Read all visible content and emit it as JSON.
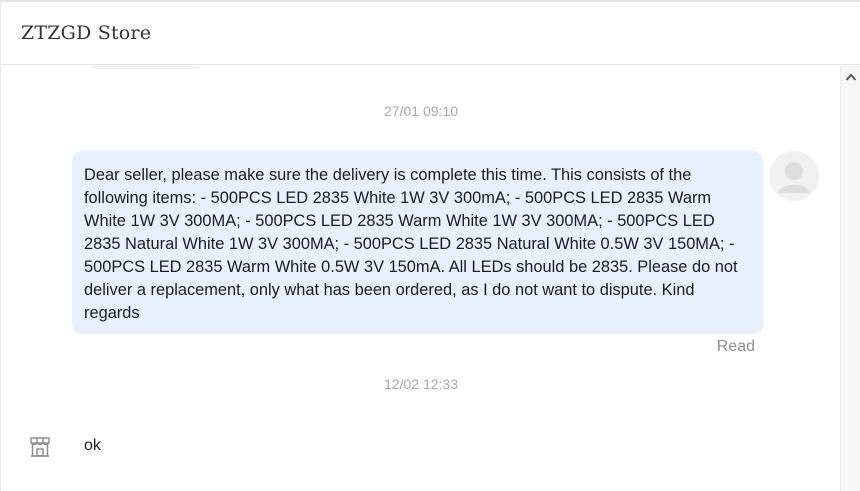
{
  "header": {
    "title": "ZTZGD Store"
  },
  "messages": [
    {
      "timestamp": "27/01 09:10",
      "sender": "user",
      "text": "Dear seller, please make sure the delivery is complete this time. This consists of the following items: - 500PCS LED 2835 White 1W 3V 300mA; - 500PCS LED 2835 Warm White 1W 3V 300MA; - 500PCS LED 2835 Warm White 1W 3V 300MA; - 500PCS LED 2835 Natural White 1W 3V 300MA; - 500PCS LED 2835 Natural White 0.5W 3V 150MA; - 500PCS LED 2835 Warm White 0.5W 3V 150mA. All LEDs should be 2835. Please do not deliver a replacement, only what has been ordered, as I do not want to dispute. Kind regards",
      "status": "Read",
      "avatar_icon": "user-avatar-icon"
    },
    {
      "timestamp": "12/02 12:33",
      "sender": "store",
      "text": "ok",
      "avatar_icon": "store-icon"
    }
  ],
  "colors": {
    "user_bubble": "#e7f0fd",
    "timestamp": "#a9a9a9",
    "read_status": "#8f8f8f"
  }
}
